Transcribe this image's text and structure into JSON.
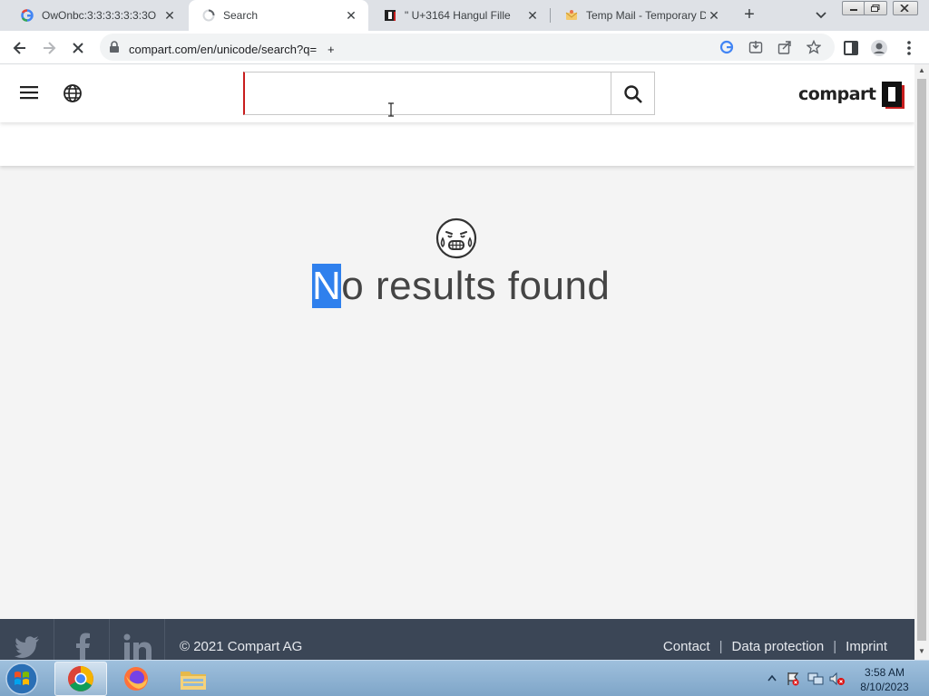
{
  "browser": {
    "tabs": [
      {
        "title": "OwOnbc:3:3:3:3:3:3:3O",
        "active": false
      },
      {
        "title": "Search",
        "active": true,
        "loading": true
      },
      {
        "title": "\" U+3164 Hangul Fille",
        "active": false
      },
      {
        "title": "Temp Mail - Temporary D",
        "active": false
      }
    ],
    "url": "compart.com/en/unicode/search?q=ㅤ+"
  },
  "site": {
    "search_value": "ㅤ",
    "logo_text": "compart",
    "message_highlight": "N",
    "message_rest": "o results found",
    "footer": {
      "copyright": "© 2021 Compart AG",
      "links": [
        "Contact",
        "Data protection",
        "Imprint"
      ]
    }
  },
  "taskbar": {
    "time": "3:58 AM",
    "date": "8/10/2023"
  },
  "colors": {
    "accent_red": "#c81e1e",
    "footer_bg": "#3b4656",
    "highlight": "#2f80ed"
  }
}
